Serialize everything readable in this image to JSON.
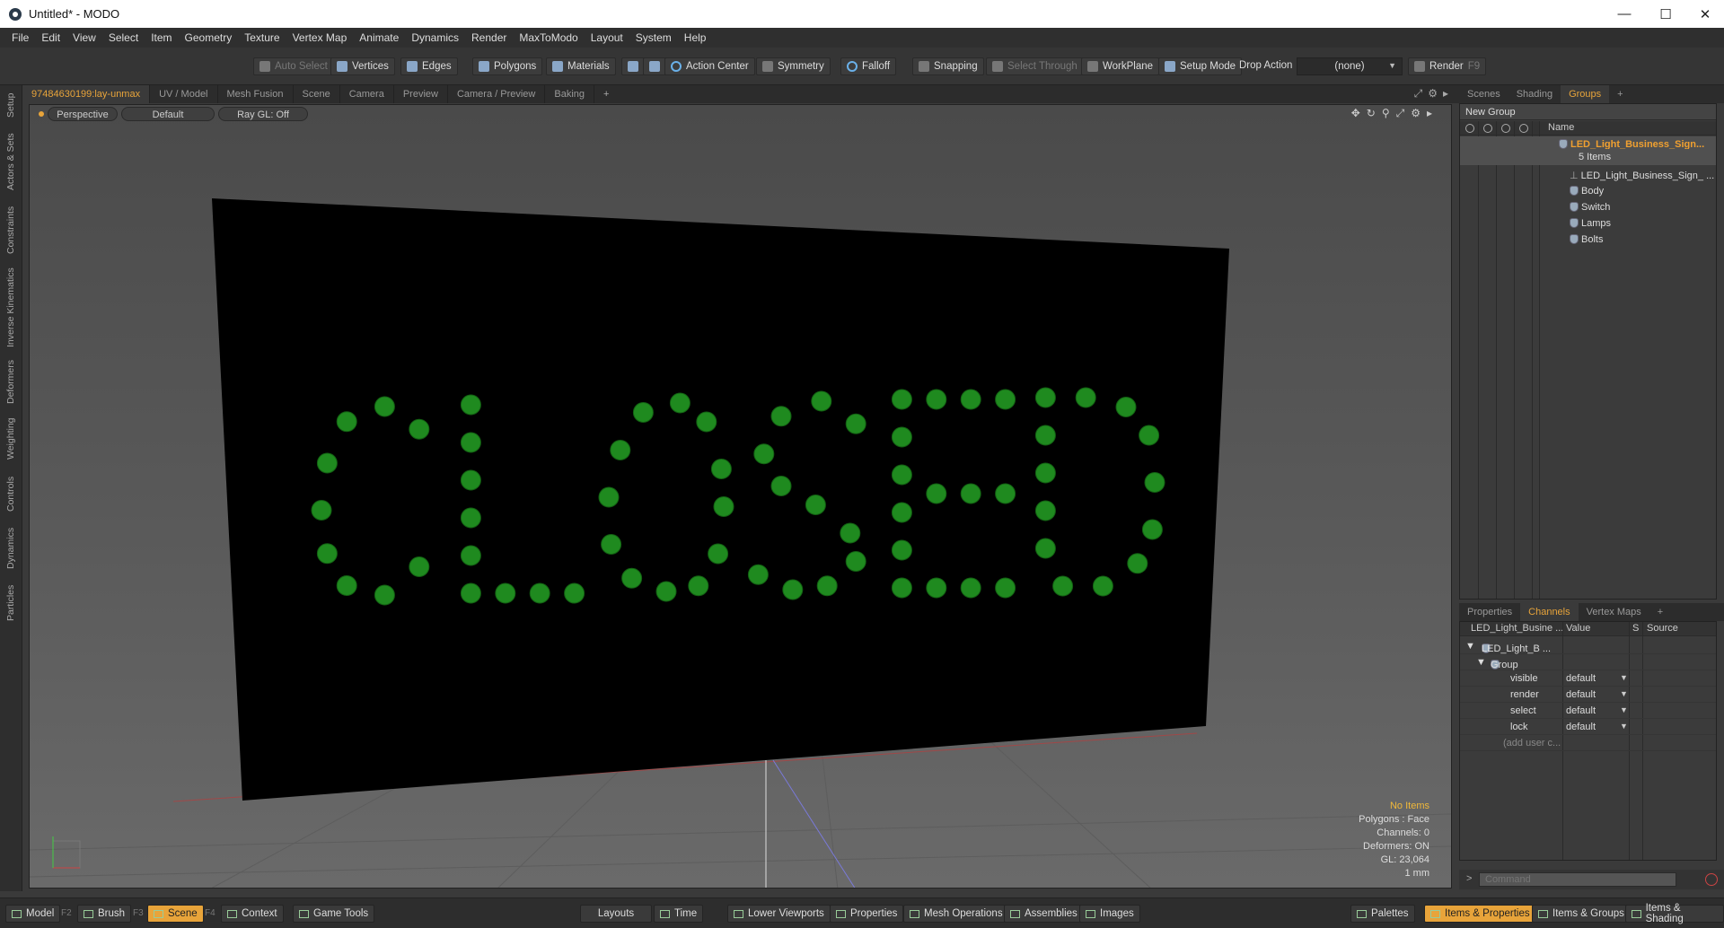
{
  "window": {
    "title": "Untitled* - MODO",
    "minimize": "—",
    "maximize": "☐",
    "close": "✕"
  },
  "menu": [
    "File",
    "Edit",
    "View",
    "Select",
    "Item",
    "Geometry",
    "Texture",
    "Vertex Map",
    "Animate",
    "Dynamics",
    "Render",
    "MaxToModo",
    "Layout",
    "System",
    "Help"
  ],
  "toolbar": {
    "auto_select": "Auto Select",
    "vertices": "Vertices",
    "edges": "Edges",
    "polygons": "Polygons",
    "materials": "Materials",
    "action_center": "Action Center",
    "symmetry": "Symmetry",
    "falloff": "Falloff",
    "snapping": "Snapping",
    "select_through": "Select Through",
    "workplane": "WorkPlane",
    "setup_mode": "Setup Mode",
    "drop_action": "Drop Action",
    "drop_action_value": "(none)",
    "render": "Render",
    "render_key": "F9"
  },
  "left_tabs": [
    "Setup",
    "Actors & Sets",
    "Constraints",
    "Inverse Kinematics",
    "Deformers",
    "Weighting",
    "Controls",
    "Dynamics",
    "Particles"
  ],
  "viewport_tabs": [
    "97484630199:lay-unmax",
    "UV / Model",
    "Mesh Fusion",
    "Scene",
    "Camera",
    "Preview",
    "Camera / Preview",
    "Baking",
    "+"
  ],
  "viewport": {
    "view": "Perspective",
    "shading": "Default",
    "raygl": "Ray GL: Off",
    "sign_text": "CLOSED",
    "colors": {
      "sign": "#000000",
      "led": "#1f8a1f"
    },
    "info": {
      "items": "No Items",
      "polygons": "Polygons : Face",
      "channels": "Channels: 0",
      "deformers": "Deformers: ON",
      "gl": "GL: 23,064",
      "scale": "1 mm"
    }
  },
  "right_top_tabs": [
    "Scenes",
    "Shading",
    "Groups",
    "+"
  ],
  "groups": {
    "new_group": "New Group",
    "name_header": "Name",
    "root": {
      "name": "LED_Light_Business_Sign...",
      "count": "5 Items"
    },
    "children": [
      "LED_Light_Business_Sign_ ...",
      "Body",
      "Switch",
      "Lamps",
      "Bolts"
    ]
  },
  "right_bottom_tabs": [
    "Properties",
    "Channels",
    "Vertex Maps",
    "+"
  ],
  "channels": {
    "header": {
      "name": "LED_Light_Busine ...",
      "value": "Value",
      "s": "S",
      "source": "Source"
    },
    "item": "LED_Light_B ...",
    "group": "Group",
    "rows": [
      {
        "name": "visible",
        "value": "default"
      },
      {
        "name": "render",
        "value": "default"
      },
      {
        "name": "select",
        "value": "default"
      },
      {
        "name": "lock",
        "value": "default"
      }
    ],
    "add_user": "(add user c..."
  },
  "command": {
    "prompt": ">",
    "placeholder": "Command"
  },
  "bottom": {
    "model": "Model",
    "model_key": "F2",
    "brush": "Brush",
    "brush_key": "F3",
    "scene": "Scene",
    "scene_key": "F4",
    "context": "Context",
    "game_tools": "Game Tools",
    "layouts": "Layouts",
    "time": "Time",
    "lower_viewports": "Lower Viewports",
    "properties": "Properties",
    "mesh_operations": "Mesh Operations",
    "assemblies": "Assemblies",
    "images": "Images",
    "palettes": "Palettes",
    "items_properties": "Items & Properties",
    "items_groups": "Items & Groups",
    "items_shading": "Items & Shading"
  }
}
